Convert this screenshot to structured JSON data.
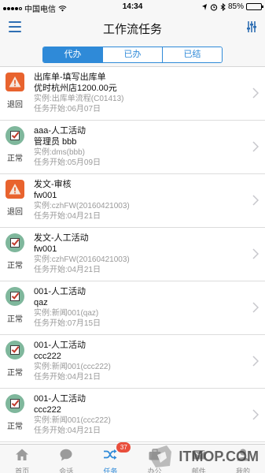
{
  "status_bar": {
    "carrier": "中国电信",
    "time": "14:34",
    "battery_text": "85%",
    "battery_level": 0.85
  },
  "nav": {
    "title": "工作流任务",
    "menu_icon": "hamburger-menu-icon",
    "filter_icon": "filter-sliders-icon"
  },
  "segments": [
    {
      "label": "代办",
      "active": true
    },
    {
      "label": "已办",
      "active": false
    },
    {
      "label": "已结",
      "active": false
    }
  ],
  "colors": {
    "accent": "#2f8ad8",
    "return_icon_bg": "#e8632e",
    "normal_icon_bg": "#7fb79c",
    "badge": "#e94e3c"
  },
  "tasks": [
    {
      "status": "退回",
      "status_type": "return",
      "title": "出库单-填写出库单",
      "subtitle": "优时杭州店1200.00元",
      "instance": "实例:出库单流程(C01413)",
      "start": "任务开始:06月07日"
    },
    {
      "status": "正常",
      "status_type": "normal",
      "title": "aaa-人工活动",
      "subtitle": "管理员 bbb",
      "instance": "实例:dms(bbb)",
      "start": "任务开始:05月09日"
    },
    {
      "status": "退回",
      "status_type": "return",
      "title": "发文-审核",
      "subtitle": "fw001",
      "instance": "实例:czhFW(20160421003)",
      "start": "任务开始:04月21日"
    },
    {
      "status": "正常",
      "status_type": "normal",
      "title": "发文-人工活动",
      "subtitle": "fw001",
      "instance": "实例:czhFW(20160421003)",
      "start": "任务开始:04月21日"
    },
    {
      "status": "正常",
      "status_type": "normal",
      "title": "001-人工活动",
      "subtitle": "qaz",
      "instance": "实例:新闻001(qaz)",
      "start": "任务开始:07月15日"
    },
    {
      "status": "正常",
      "status_type": "normal",
      "title": "001-人工活动",
      "subtitle": "ccc222",
      "instance": "实例:新闻001(ccc222)",
      "start": "任务开始:04月21日"
    },
    {
      "status": "正常",
      "status_type": "normal",
      "title": "001-人工活动",
      "subtitle": "ccc222",
      "instance": "实例:新闻001(ccc222)",
      "start": "任务开始:04月21日"
    }
  ],
  "tabs": [
    {
      "label": "首页",
      "icon": "home-icon",
      "active": false
    },
    {
      "label": "会话",
      "icon": "chat-icon",
      "active": false
    },
    {
      "label": "任务",
      "icon": "task-shuffle-icon",
      "active": true,
      "badge": "37"
    },
    {
      "label": "办公",
      "icon": "office-icon",
      "active": false
    },
    {
      "label": "邮件",
      "icon": "mail-icon",
      "active": false
    },
    {
      "label": "我的",
      "icon": "profile-icon",
      "active": false
    }
  ],
  "watermark": {
    "text": "ITMOP.COM"
  }
}
